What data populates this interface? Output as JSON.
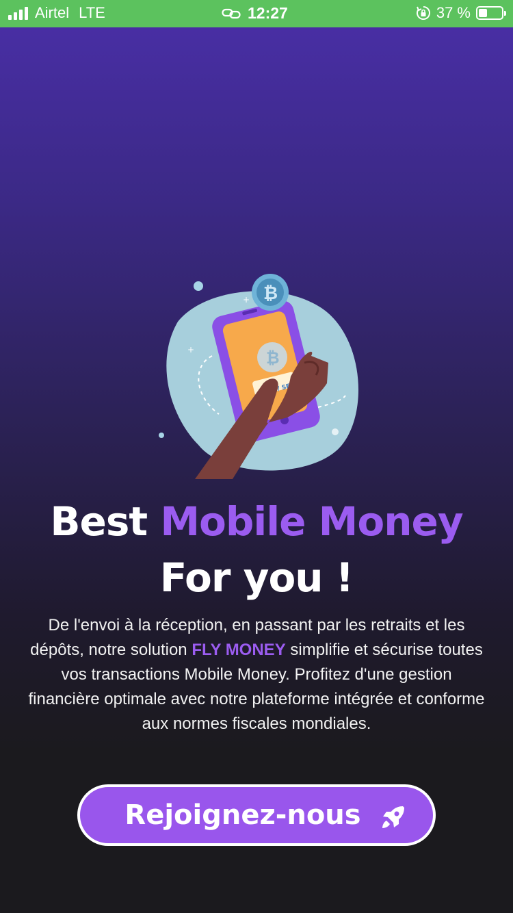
{
  "status_bar": {
    "carrier": "Airtel",
    "network": "LTE",
    "time": "12:27",
    "battery_text": "37 %",
    "battery_level": 0.37
  },
  "illustration": {
    "button_text": "BUY / SELL"
  },
  "headline": {
    "line1_prefix": "Best",
    "line1_accent": "Mobile Money",
    "line2": "For you !"
  },
  "description": {
    "part1": "De l'envoi à la réception, en passant par les retraits et les dépôts, notre solution",
    "brand": "FLY MONEY",
    "part2": "simplifie et sécurise toutes vos transactions Mobile Money. Profitez d'une gestion financière optimale avec notre plateforme intégrée et conforme aux normes fiscales mondiales."
  },
  "cta": {
    "label": "Rejoignez-nous",
    "icon": "rocket-icon"
  },
  "colors": {
    "accent": "#9b5cf0",
    "status_bar": "#5cc25e",
    "button": "#9956ec"
  }
}
